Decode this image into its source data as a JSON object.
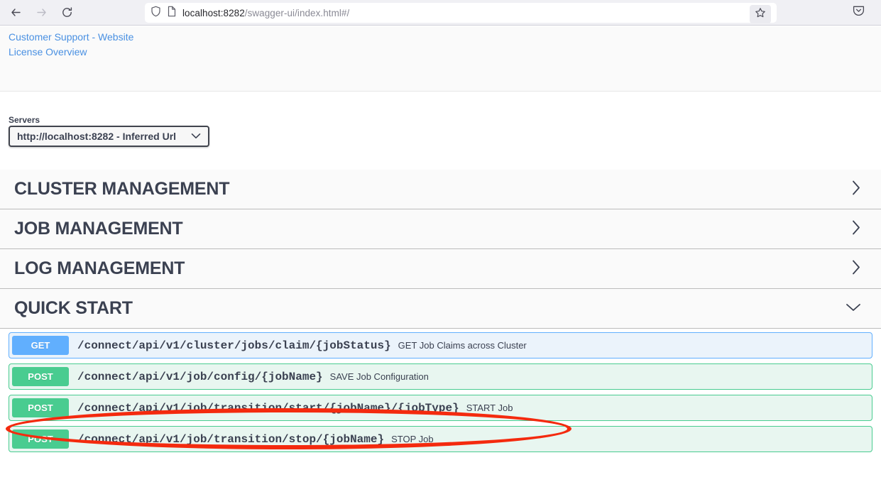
{
  "browser": {
    "back_icon": "back-arrow-icon",
    "forward_icon": "forward-arrow-icon",
    "reload_icon": "reload-icon",
    "shield_icon": "shield-icon",
    "page_icon": "page-document-icon",
    "url_host": "localhost:8282",
    "url_path": "/swagger-ui/index.html#/",
    "bookmark_icon": "star-icon",
    "pocket_icon": "pocket-save-icon"
  },
  "info": {
    "links": [
      {
        "label": "Customer Support - Website"
      },
      {
        "label": "License Overview"
      }
    ]
  },
  "servers": {
    "label": "Servers",
    "selected": "http://localhost:8282 - Inferred Url",
    "caret_icon": "chevron-down-icon"
  },
  "tags": [
    {
      "title": "CLUSTER MANAGEMENT",
      "expanded": false,
      "caret_icon": "chevron-right-icon"
    },
    {
      "title": "JOB MANAGEMENT",
      "expanded": false,
      "caret_icon": "chevron-right-icon"
    },
    {
      "title": "LOG MANAGEMENT",
      "expanded": false,
      "caret_icon": "chevron-right-icon"
    },
    {
      "title": "QUICK START",
      "expanded": true,
      "caret_icon": "chevron-down-icon"
    }
  ],
  "operations": [
    {
      "method": "GET",
      "path": "/connect/api/v1/cluster/jobs/claim/{jobStatus}",
      "description": "GET Job Claims across Cluster",
      "color": "#61affe"
    },
    {
      "method": "POST",
      "path": "/connect/api/v1/job/config/{jobName}",
      "description": "SAVE Job Configuration",
      "color": "#49cc90"
    },
    {
      "method": "POST",
      "path": "/connect/api/v1/job/transition/start/{jobName}/{jobType}",
      "description": "START Job",
      "color": "#49cc90",
      "highlighted": true
    },
    {
      "method": "POST",
      "path": "/connect/api/v1/job/transition/stop/{jobName}",
      "description": "STOP Job",
      "color": "#49cc90"
    }
  ],
  "annotation": {
    "shape": "ellipse",
    "color": "#f42a0e",
    "targets": "/connect/api/v1/job/transition/start/{jobName}/{jobType}"
  }
}
